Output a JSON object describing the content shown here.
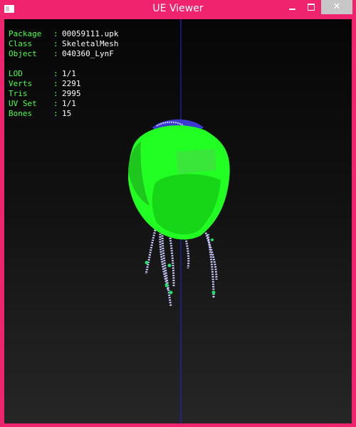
{
  "window": {
    "title": "UE Viewer",
    "title_color": "#ffffff",
    "frame_color": "#f0236e",
    "controls": {
      "minimize": "minimize-icon",
      "maximize": "maximize-icon",
      "close_glyph": "✕"
    }
  },
  "info": {
    "group1": [
      {
        "label": "Package",
        "sep": ":",
        "value": "00059111.upk"
      },
      {
        "label": "Class",
        "sep": ":",
        "value": "SkeletalMesh"
      },
      {
        "label": "Object",
        "sep": ":",
        "value": "040360_LynF"
      }
    ],
    "group2": [
      {
        "label": "LOD",
        "sep": ":",
        "value": "1/1"
      },
      {
        "label": "Verts",
        "sep": ":",
        "value": "2291"
      },
      {
        "label": "Tris",
        "sep": ":",
        "value": "2995"
      },
      {
        "label": "UV Set",
        "sep": ":",
        "value": "1/1"
      },
      {
        "label": "Bones",
        "sep": ":",
        "value": "15"
      }
    ],
    "label_color": "#4cff4c",
    "value_color": "#ffffff"
  },
  "colors": {
    "mesh": "#22ff22",
    "mesh_shadow": "#15c915",
    "axis": "#2020c8",
    "skeleton": "#c8c8ff",
    "bone_joint": "#22dd66"
  }
}
